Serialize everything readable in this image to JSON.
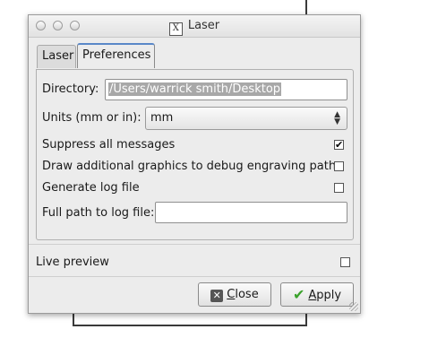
{
  "window": {
    "title": "Laser",
    "title_icon": "X"
  },
  "tabs": [
    {
      "label": "Laser",
      "active": false
    },
    {
      "label": "Preferences",
      "active": true
    }
  ],
  "preferences": {
    "directory_label": "Directory:",
    "directory_value": "/Users/warrick smith/Desktop",
    "units_label": "Units (mm or in):",
    "units_value": "mm",
    "suppress_label": "Suppress all messages",
    "suppress_checked": true,
    "debug_graphics_label": "Draw additional graphics to debug engraving path",
    "debug_graphics_checked": false,
    "log_file_label": "Generate log file",
    "log_file_checked": false,
    "log_path_label": "Full path to log file:",
    "log_path_value": ""
  },
  "live_preview": {
    "label": "Live preview",
    "checked": false
  },
  "buttons": {
    "close_mnemonic": "C",
    "close_rest": "lose",
    "apply_mnemonic": "A",
    "apply_rest": "pply"
  },
  "icons": {
    "close": "close-icon",
    "apply": "checkmark-icon",
    "check": "✔"
  }
}
